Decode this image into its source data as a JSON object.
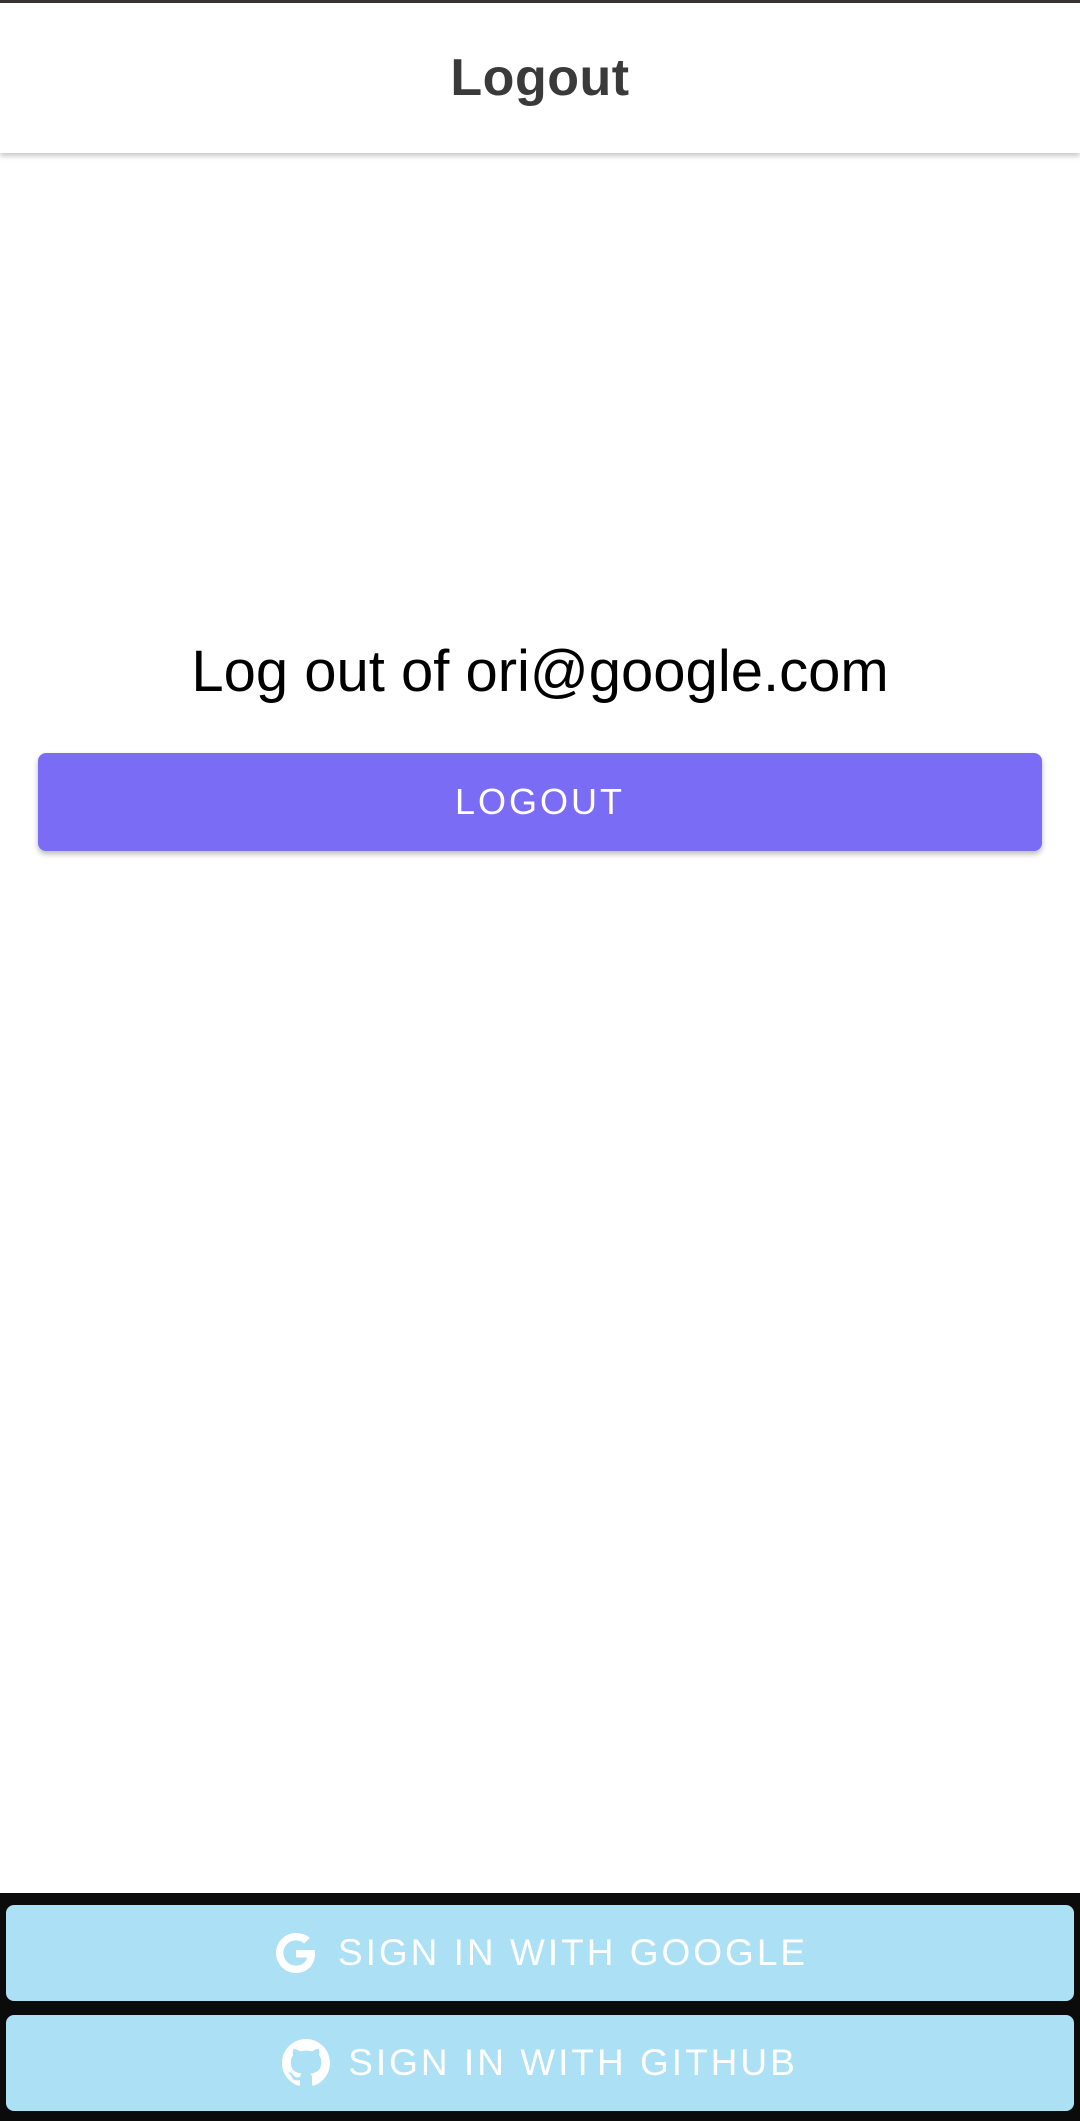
{
  "app_bar": {
    "title": "Logout"
  },
  "main": {
    "heading": "Log out of ori@google.com",
    "logout_button_label": "LOGOUT"
  },
  "auth_buttons": {
    "google": {
      "label": "SIGN IN WITH GOOGLE",
      "icon": "google-icon"
    },
    "github": {
      "label": "SIGN IN WITH GITHUB",
      "icon": "github-icon"
    }
  },
  "colors": {
    "primary_button": "#7b6cf6",
    "auth_button": "#abe0f5",
    "bottom_bar": "#0b0b0b",
    "app_bar_title": "#3a3a3a"
  }
}
